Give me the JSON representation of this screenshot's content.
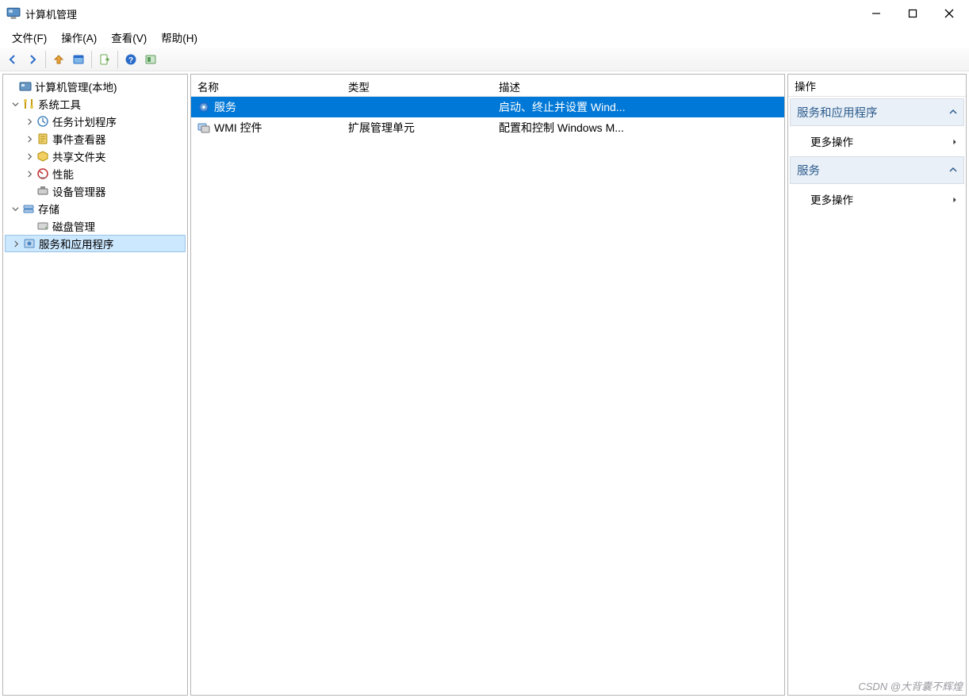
{
  "window": {
    "title": "计算机管理"
  },
  "menu": {
    "file": "文件(F)",
    "action": "操作(A)",
    "view": "查看(V)",
    "help": "帮助(H)"
  },
  "tree": {
    "root": "计算机管理(本地)",
    "system_tools": {
      "label": "系统工具",
      "task_scheduler": "任务计划程序",
      "event_viewer": "事件查看器",
      "shared_folders": "共享文件夹",
      "performance": "性能",
      "device_manager": "设备管理器"
    },
    "storage": {
      "label": "存储",
      "disk_management": "磁盘管理"
    },
    "services_apps": {
      "label": "服务和应用程序"
    }
  },
  "list": {
    "columns": {
      "name": "名称",
      "type": "类型",
      "desc": "描述"
    },
    "rows": [
      {
        "name": "服务",
        "type": "",
        "desc": "启动、终止并设置 Wind...",
        "icon": "gear"
      },
      {
        "name": "WMI 控件",
        "type": "扩展管理单元",
        "desc": "配置和控制 Windows M...",
        "icon": "wmi"
      }
    ]
  },
  "actions": {
    "header": "操作",
    "section1": "服务和应用程序",
    "more1": "更多操作",
    "section2": "服务",
    "more2": "更多操作"
  },
  "watermark": "CSDN @大背囊不辉煌"
}
